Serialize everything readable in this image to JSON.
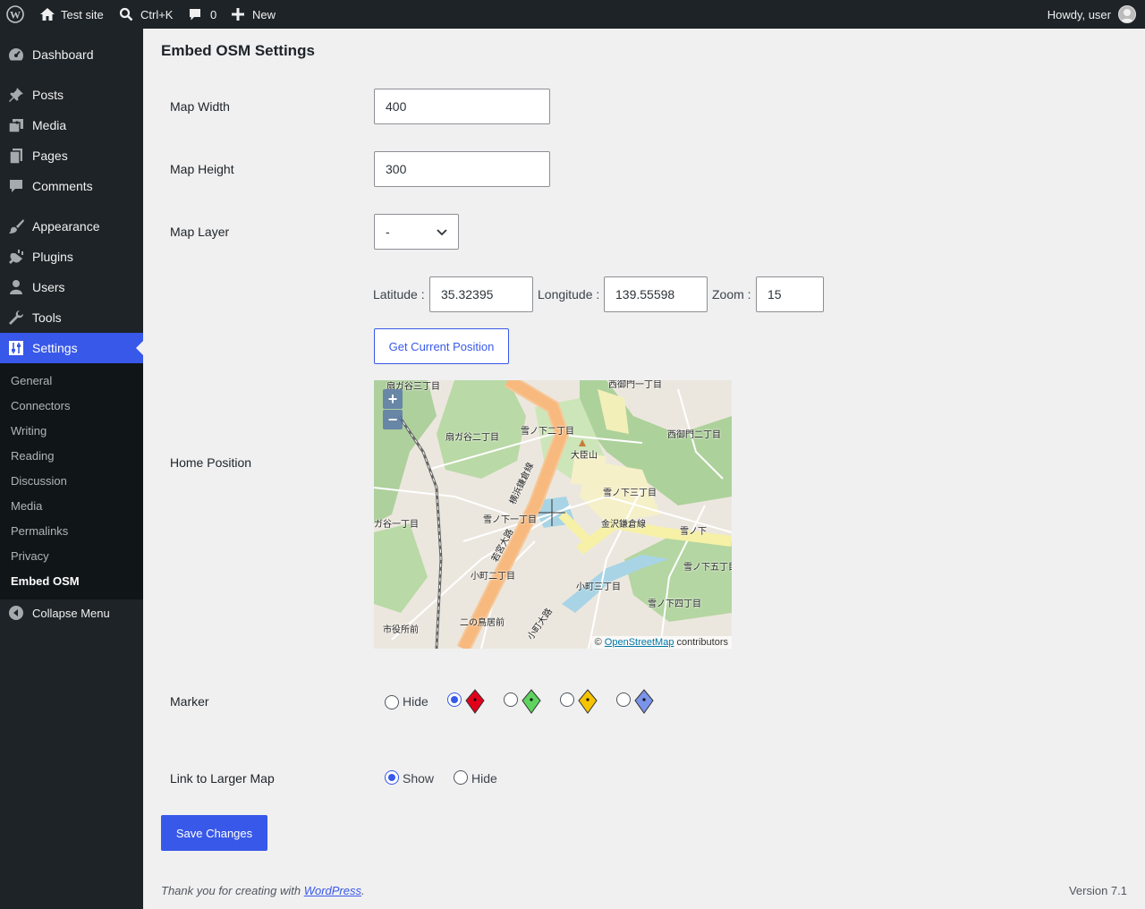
{
  "adminbar": {
    "site_name": "Test site",
    "search_shortcut": "Ctrl+K",
    "comments_count": "0",
    "new_label": "New",
    "howdy": "Howdy, user"
  },
  "sidebar": {
    "items": [
      {
        "label": "Dashboard",
        "icon": "dashboard-icon"
      },
      {
        "label": "Posts",
        "icon": "pin-icon"
      },
      {
        "label": "Media",
        "icon": "media-icon"
      },
      {
        "label": "Pages",
        "icon": "pages-icon"
      },
      {
        "label": "Comments",
        "icon": "comments-icon"
      },
      {
        "label": "Appearance",
        "icon": "brush-icon"
      },
      {
        "label": "Plugins",
        "icon": "plugin-icon"
      },
      {
        "label": "Users",
        "icon": "users-icon"
      },
      {
        "label": "Tools",
        "icon": "wrench-icon"
      },
      {
        "label": "Settings",
        "icon": "settings-icon"
      }
    ],
    "submenu": [
      "General",
      "Connectors",
      "Writing",
      "Reading",
      "Discussion",
      "Media",
      "Permalinks",
      "Privacy",
      "Embed OSM"
    ],
    "collapse": "Collapse Menu"
  },
  "page": {
    "title": "Embed OSM Settings",
    "map_width_label": "Map Width",
    "map_width_value": "400",
    "map_height_label": "Map Height",
    "map_height_value": "300",
    "map_layer_label": "Map Layer",
    "map_layer_value": "-",
    "home_position_label": "Home Position",
    "latitude_label": "Latitude :",
    "latitude_value": "35.32395",
    "longitude_label": "Longitude :",
    "longitude_value": "139.55598",
    "zoom_label": "Zoom :",
    "zoom_value": "15",
    "get_position_button": "Get Current Position",
    "map_zoom_in": "+",
    "map_zoom_out": "−",
    "attribution_prefix": "©",
    "attribution_link": "OpenStreetMap",
    "attribution_suffix": "contributors",
    "map_labels": [
      "扇ガ谷三丁目",
      "扇ガ谷二丁目",
      "雪ノ下二丁目",
      "西御門一丁目",
      "西御門二丁目",
      "大臣山",
      "雪ノ下三丁目",
      "ガ谷一丁目",
      "雪ノ下一丁目",
      "金沢鎌倉線",
      "雪ノ下",
      "雪ノ下五丁目",
      "小町二丁目",
      "小町三丁目",
      "雪ノ下四丁目",
      "二の鳥居前",
      "市役所前",
      "若宮大路",
      "横浜鎌倉線",
      "小町大路"
    ],
    "marker_label": "Marker",
    "marker_hide": "Hide",
    "marker_colors": [
      "#e2001a",
      "#5fd35f",
      "#f5c400",
      "#7b93e8"
    ],
    "link_label": "Link to Larger Map",
    "link_show": "Show",
    "link_hide": "Hide",
    "save_button": "Save Changes"
  },
  "footer": {
    "thanks_prefix": "Thank you for creating with",
    "thanks_link": "WordPress",
    "version": "Version 7.1"
  }
}
